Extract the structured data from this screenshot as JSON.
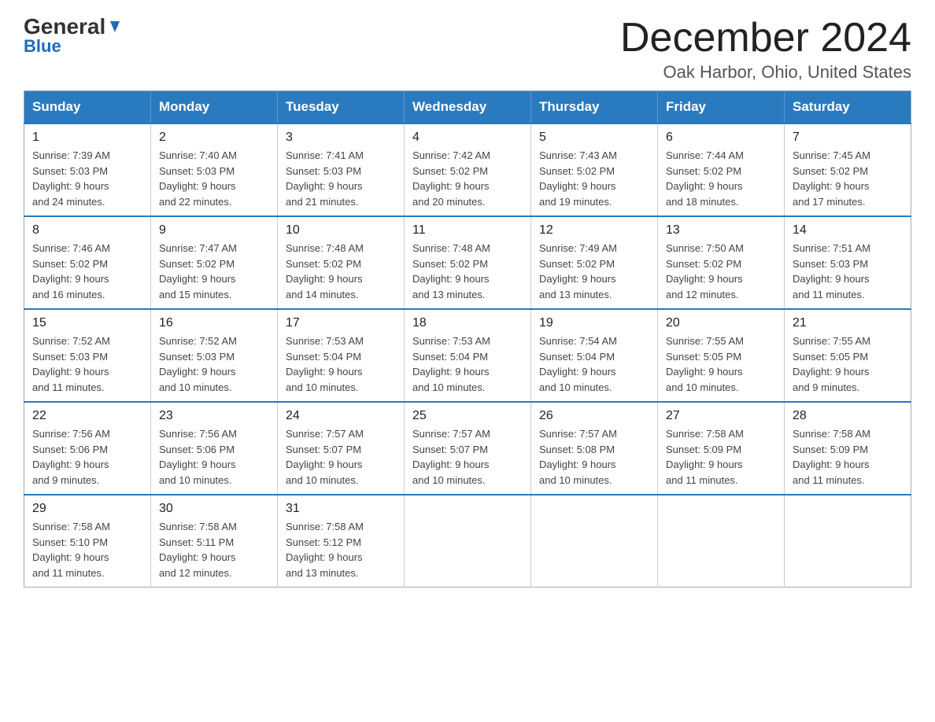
{
  "header": {
    "logo_line1": "General",
    "logo_line2": "Blue",
    "month_title": "December 2024",
    "location": "Oak Harbor, Ohio, United States"
  },
  "weekdays": [
    "Sunday",
    "Monday",
    "Tuesday",
    "Wednesday",
    "Thursday",
    "Friday",
    "Saturday"
  ],
  "weeks": [
    [
      {
        "day": "1",
        "sunrise": "7:39 AM",
        "sunset": "5:03 PM",
        "daylight": "9 hours and 24 minutes."
      },
      {
        "day": "2",
        "sunrise": "7:40 AM",
        "sunset": "5:03 PM",
        "daylight": "9 hours and 22 minutes."
      },
      {
        "day": "3",
        "sunrise": "7:41 AM",
        "sunset": "5:03 PM",
        "daylight": "9 hours and 21 minutes."
      },
      {
        "day": "4",
        "sunrise": "7:42 AM",
        "sunset": "5:02 PM",
        "daylight": "9 hours and 20 minutes."
      },
      {
        "day": "5",
        "sunrise": "7:43 AM",
        "sunset": "5:02 PM",
        "daylight": "9 hours and 19 minutes."
      },
      {
        "day": "6",
        "sunrise": "7:44 AM",
        "sunset": "5:02 PM",
        "daylight": "9 hours and 18 minutes."
      },
      {
        "day": "7",
        "sunrise": "7:45 AM",
        "sunset": "5:02 PM",
        "daylight": "9 hours and 17 minutes."
      }
    ],
    [
      {
        "day": "8",
        "sunrise": "7:46 AM",
        "sunset": "5:02 PM",
        "daylight": "9 hours and 16 minutes."
      },
      {
        "day": "9",
        "sunrise": "7:47 AM",
        "sunset": "5:02 PM",
        "daylight": "9 hours and 15 minutes."
      },
      {
        "day": "10",
        "sunrise": "7:48 AM",
        "sunset": "5:02 PM",
        "daylight": "9 hours and 14 minutes."
      },
      {
        "day": "11",
        "sunrise": "7:48 AM",
        "sunset": "5:02 PM",
        "daylight": "9 hours and 13 minutes."
      },
      {
        "day": "12",
        "sunrise": "7:49 AM",
        "sunset": "5:02 PM",
        "daylight": "9 hours and 13 minutes."
      },
      {
        "day": "13",
        "sunrise": "7:50 AM",
        "sunset": "5:02 PM",
        "daylight": "9 hours and 12 minutes."
      },
      {
        "day": "14",
        "sunrise": "7:51 AM",
        "sunset": "5:03 PM",
        "daylight": "9 hours and 11 minutes."
      }
    ],
    [
      {
        "day": "15",
        "sunrise": "7:52 AM",
        "sunset": "5:03 PM",
        "daylight": "9 hours and 11 minutes."
      },
      {
        "day": "16",
        "sunrise": "7:52 AM",
        "sunset": "5:03 PM",
        "daylight": "9 hours and 10 minutes."
      },
      {
        "day": "17",
        "sunrise": "7:53 AM",
        "sunset": "5:04 PM",
        "daylight": "9 hours and 10 minutes."
      },
      {
        "day": "18",
        "sunrise": "7:53 AM",
        "sunset": "5:04 PM",
        "daylight": "9 hours and 10 minutes."
      },
      {
        "day": "19",
        "sunrise": "7:54 AM",
        "sunset": "5:04 PM",
        "daylight": "9 hours and 10 minutes."
      },
      {
        "day": "20",
        "sunrise": "7:55 AM",
        "sunset": "5:05 PM",
        "daylight": "9 hours and 10 minutes."
      },
      {
        "day": "21",
        "sunrise": "7:55 AM",
        "sunset": "5:05 PM",
        "daylight": "9 hours and 9 minutes."
      }
    ],
    [
      {
        "day": "22",
        "sunrise": "7:56 AM",
        "sunset": "5:06 PM",
        "daylight": "9 hours and 9 minutes."
      },
      {
        "day": "23",
        "sunrise": "7:56 AM",
        "sunset": "5:06 PM",
        "daylight": "9 hours and 10 minutes."
      },
      {
        "day": "24",
        "sunrise": "7:57 AM",
        "sunset": "5:07 PM",
        "daylight": "9 hours and 10 minutes."
      },
      {
        "day": "25",
        "sunrise": "7:57 AM",
        "sunset": "5:07 PM",
        "daylight": "9 hours and 10 minutes."
      },
      {
        "day": "26",
        "sunrise": "7:57 AM",
        "sunset": "5:08 PM",
        "daylight": "9 hours and 10 minutes."
      },
      {
        "day": "27",
        "sunrise": "7:58 AM",
        "sunset": "5:09 PM",
        "daylight": "9 hours and 11 minutes."
      },
      {
        "day": "28",
        "sunrise": "7:58 AM",
        "sunset": "5:09 PM",
        "daylight": "9 hours and 11 minutes."
      }
    ],
    [
      {
        "day": "29",
        "sunrise": "7:58 AM",
        "sunset": "5:10 PM",
        "daylight": "9 hours and 11 minutes."
      },
      {
        "day": "30",
        "sunrise": "7:58 AM",
        "sunset": "5:11 PM",
        "daylight": "9 hours and 12 minutes."
      },
      {
        "day": "31",
        "sunrise": "7:58 AM",
        "sunset": "5:12 PM",
        "daylight": "9 hours and 13 minutes."
      },
      null,
      null,
      null,
      null
    ]
  ]
}
